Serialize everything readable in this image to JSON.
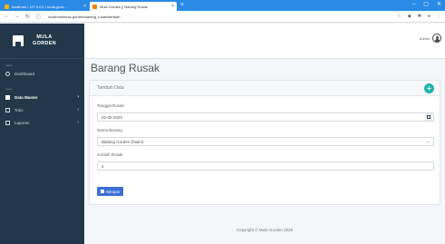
{
  "browser": {
    "tabs": [
      {
        "label": "localhost / 127.0.0.1 / mula-gord…"
      },
      {
        "label": "Mula Gorden || Barang Rusak"
      }
    ],
    "url": "localhost/mula-gorden/barang_rusak/tambah"
  },
  "sidebar": {
    "brand_line1": "MULA",
    "brand_line2": "GORDEN",
    "section1": "menu",
    "dashboard": "Dashboard",
    "section2": "menu",
    "items": [
      {
        "label": "Data Master"
      },
      {
        "label": "Toko"
      },
      {
        "label": "Laporan"
      }
    ]
  },
  "header": {
    "user": "Admin"
  },
  "page": {
    "title": "Barang Rusak"
  },
  "card": {
    "title": "Tambah Data",
    "tanggal_label": "Tanggal Rusak",
    "tanggal_value": "03-09-2020",
    "barang_label": "Nama Barang",
    "barang_value": "Blalang Gorden (hitam)",
    "jumlah_label": "Jumlah Rusak",
    "jumlah_value": "2",
    "save_label": "Simpan"
  },
  "footer": {
    "text": "Copyright © Mula Gorden 2020"
  }
}
